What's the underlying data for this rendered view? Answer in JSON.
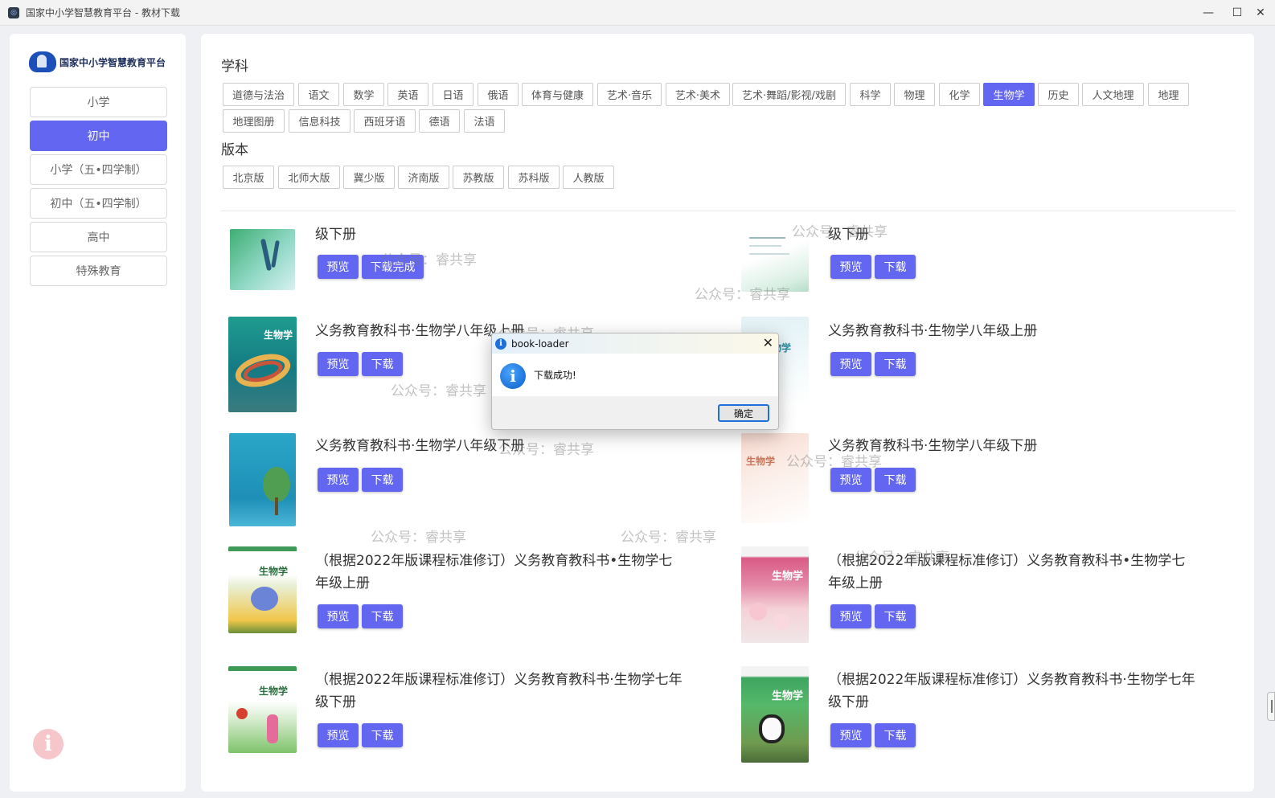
{
  "window": {
    "title": "国家中小学智慧教育平台 - 教材下载",
    "app_icon": "app-icon",
    "controls": {
      "minimize": "—",
      "maximize": "☐",
      "close": "✕"
    }
  },
  "sidebar": {
    "logo_text": "国家中小学智慧教育平台",
    "items": [
      {
        "label": "小学",
        "active": false
      },
      {
        "label": "初中",
        "active": true
      },
      {
        "label": "小学（五•四学制）",
        "active": false
      },
      {
        "label": "初中（五•四学制）",
        "active": false
      },
      {
        "label": "高中",
        "active": false
      },
      {
        "label": "特殊教育",
        "active": false
      }
    ],
    "info_icon": "i"
  },
  "filters": {
    "subject_label": "学科",
    "subjects": [
      "道德与法治",
      "语文",
      "数学",
      "英语",
      "日语",
      "俄语",
      "体育与健康",
      "艺术·音乐",
      "艺术·美术",
      "艺术·舞蹈/影视/戏剧",
      "科学",
      "物理",
      "化学",
      "生物学",
      "历史",
      "人文地理",
      "地理",
      "地理图册",
      "信息科技",
      "西班牙语",
      "德语",
      "法语"
    ],
    "active_subject": "生物学",
    "edition_label": "版本",
    "editions": [
      "北京版",
      "北师大版",
      "冀少版",
      "济南版",
      "苏教版",
      "苏科版",
      "人教版"
    ]
  },
  "books": [
    {
      "title": "级下册",
      "buttons": [
        "预览",
        "下载完成"
      ]
    },
    {
      "title": "级下册",
      "buttons": [
        "预览",
        "下载"
      ]
    },
    {
      "title": "义务教育教科书·生物学八年级上册",
      "buttons": [
        "预览",
        "下载"
      ]
    },
    {
      "title": "义务教育教科书·生物学八年级上册",
      "buttons": [
        "预览",
        "下载"
      ]
    },
    {
      "title": "义务教育教科书·生物学八年级下册",
      "buttons": [
        "预览",
        "下载"
      ]
    },
    {
      "title": "义务教育教科书·生物学八年级下册",
      "buttons": [
        "预览",
        "下载"
      ]
    },
    {
      "title_lines": [
        "（根据2022年版课程标准修订）义务教育教科书•生物学七",
        "年级上册"
      ],
      "buttons": [
        "预览",
        "下载"
      ]
    },
    {
      "title_lines": [
        "（根据2022年版课程标准修订）义务教育教科书•生物学七",
        "年级上册"
      ],
      "buttons": [
        "预览",
        "下载"
      ]
    },
    {
      "title_lines": [
        "（根据2022年版课程标准修订）义务教育教科书·生物学七年",
        "级下册"
      ],
      "buttons": [
        "预览",
        "下载"
      ]
    },
    {
      "title_lines": [
        "（根据2022年版课程标准修订）义务教育教科书·生物学七年",
        "级下册"
      ],
      "buttons": [
        "预览",
        "下载"
      ]
    }
  ],
  "covers": {
    "label": "生物学"
  },
  "watermark": "公众号：睿共享",
  "dialog": {
    "title": "book-loader",
    "message": "下载成功!",
    "ok": "确定",
    "close": "✕",
    "icon": "i"
  },
  "colors": {
    "accent": "#6366f1"
  }
}
